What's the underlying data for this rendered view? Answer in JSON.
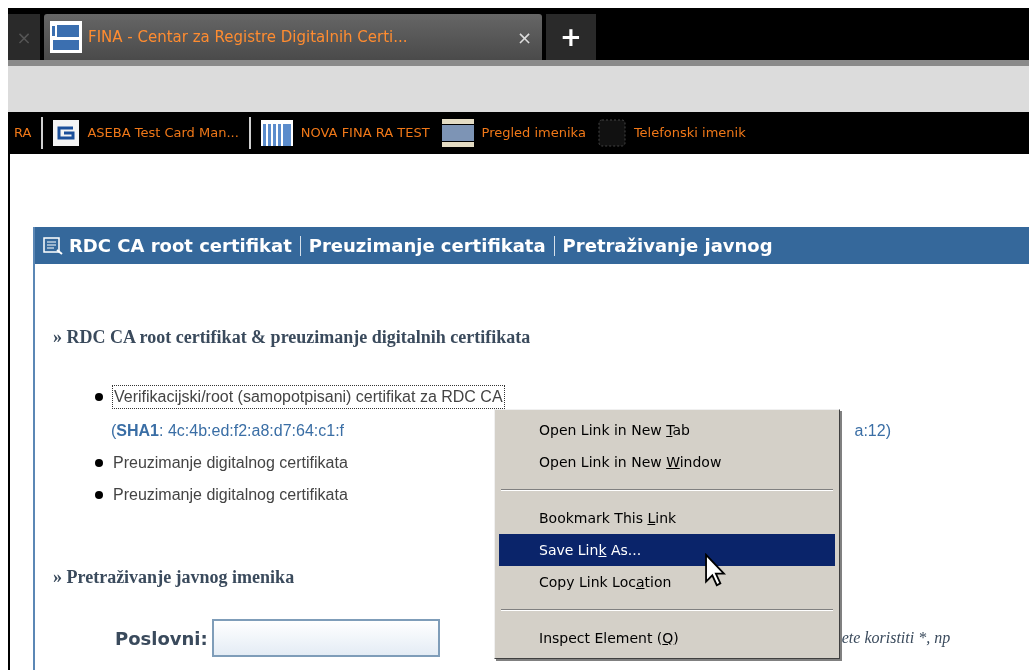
{
  "tabs": [
    {
      "selected": false,
      "close": "×"
    },
    {
      "title": "FINA - Centar za Registre Digitalnih Certi...",
      "selected": true,
      "close": "×"
    }
  ],
  "new_tab": "+",
  "bookmarks": [
    {
      "label": "RA",
      "separator_after": true
    },
    {
      "label": "ASEBA Test Card Man...",
      "separator_after": true
    },
    {
      "label": "NOVA FINA RA TEST",
      "separator_after": false
    },
    {
      "label": "Pregled imenika",
      "separator_after": false
    },
    {
      "label": "Telefonski imenik",
      "separator_after": false
    }
  ],
  "panel": {
    "header_links": [
      "RDC CA root certifikat",
      "Preuzimanje certifikata",
      "Pretraživanje javnog"
    ],
    "section_1": {
      "title": "» RDC CA root certifikat & preuzimanje digitalnih certifikata",
      "items": [
        {
          "text": "Verifikacijski/root (samopotpisani) certifikat za RDC CA",
          "focused": true,
          "hash_start": "(**SHA1**: 4c:4b:ed:f2:a8:d7:64:c1:f",
          "hash_end": "a:12)"
        },
        {
          "text": "Preuzimanje digitalnog certifikata",
          "focused": false
        },
        {
          "text": "Preuzimanje digitalnog certifikata",
          "focused": false
        }
      ]
    },
    "section_2": {
      "title": "» Pretraživanje javnog imenika",
      "field_label": "Poslovni:",
      "hint": "ete koristiti *, np"
    }
  },
  "context_menu": [
    {
      "kind": "item",
      "before": "Open Link in New ",
      "key": "T",
      "after": "ab",
      "selected": false
    },
    {
      "kind": "item",
      "before": "Open Link in New ",
      "key": "W",
      "after": "indow",
      "selected": false
    },
    {
      "kind": "separator"
    },
    {
      "kind": "item",
      "before": "Bookmark This ",
      "key": "L",
      "after": "ink",
      "selected": false
    },
    {
      "kind": "item",
      "before": "Save Lin",
      "key": "k",
      "after": " As...",
      "selected": true
    },
    {
      "kind": "item",
      "before": "Copy Link Loc",
      "key": "a",
      "after": "tion",
      "selected": false
    },
    {
      "kind": "separator"
    },
    {
      "kind": "item",
      "before": "Inspect Element (",
      "key": "Q",
      "after": ")",
      "selected": false
    }
  ]
}
